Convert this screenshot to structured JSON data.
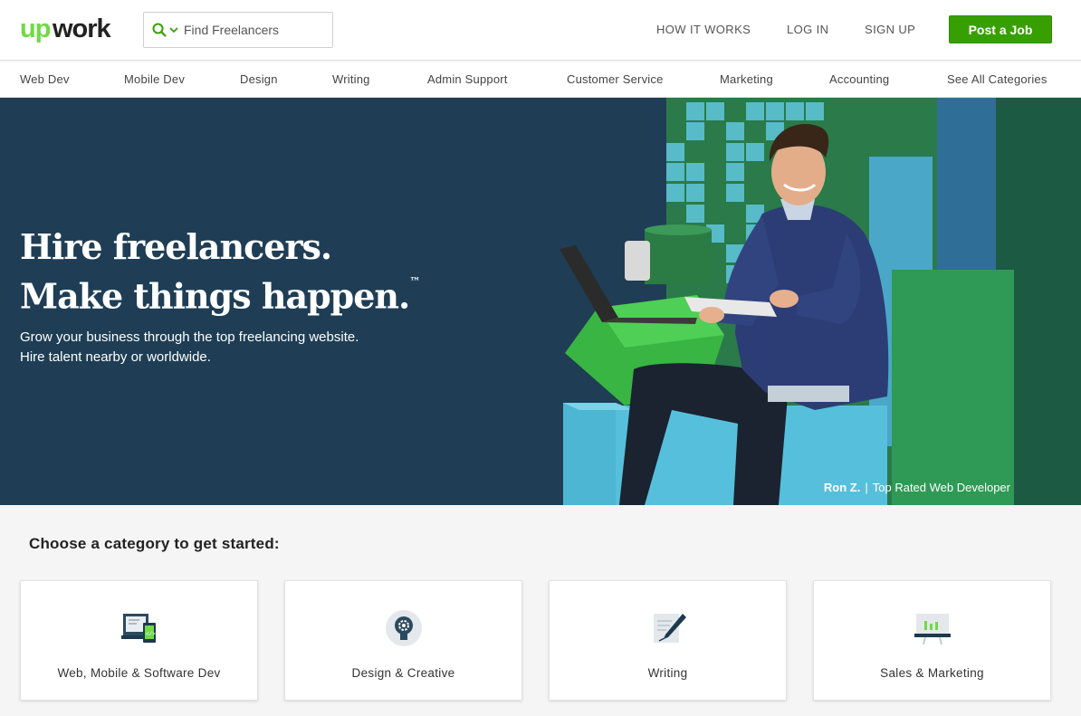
{
  "brand": {
    "logo_text": "upwork",
    "accent": "#37a000",
    "logo_dark": "#222222",
    "hero_bg": "#1f3e55"
  },
  "header": {
    "search": {
      "placeholder": "Find Freelancers",
      "icon": "search-icon",
      "dropdown_icon": "chevron-down-icon"
    },
    "nav": {
      "how_it_works": "HOW IT WORKS",
      "log_in": "LOG IN",
      "sign_up": "SIGN UP"
    },
    "post_job_label": "Post a Job"
  },
  "categories_nav": [
    "Web Dev",
    "Mobile Dev",
    "Design",
    "Writing",
    "Admin Support",
    "Customer Service",
    "Marketing",
    "Accounting",
    "See All Categories"
  ],
  "hero": {
    "headline_line1": "Hire freelancers.",
    "headline_line2": "Make things happen.",
    "trademark": "™",
    "subtitle": "Grow your business through the top freelancing website. Hire talent nearby or worldwide.",
    "caption_name": "Ron Z.",
    "caption_sep": "|",
    "caption_title": "Top Rated Web Developer"
  },
  "categories_section": {
    "heading": "Choose a category to get started:",
    "cards": [
      {
        "label": "Web, Mobile & Software Dev",
        "icon": "devices-icon"
      },
      {
        "label": "Design & Creative",
        "icon": "lightbulb-icon"
      },
      {
        "label": "Writing",
        "icon": "pen-icon"
      },
      {
        "label": "Sales & Marketing",
        "icon": "chart-board-icon"
      }
    ]
  }
}
